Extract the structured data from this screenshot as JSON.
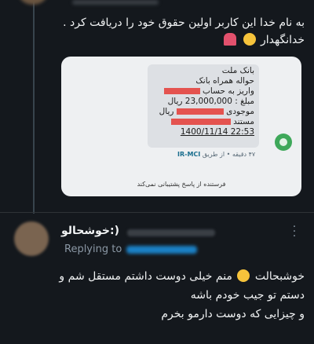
{
  "tweet": {
    "line1": "به نام خدا این کاربر اولین حقوق خود را دریافت کرد .",
    "line2": "خدانگهدار"
  },
  "sms": {
    "line1": "بانک ملت",
    "line2": "حواله همراه بانک",
    "line3": "واریز به حساب",
    "line4": "مبلغ : 23,000,000 ریال",
    "line5": "موجودی",
    "line5b": "ریال",
    "line6": "مستند",
    "line7": "22:53 1400/11/14",
    "meta_time": "۴۷ دقیقه",
    "meta_via": "از طریق",
    "meta_operator": "IR-MCI",
    "footer": "فرستنده از پاسخ پشتیبانی نمی‌کند"
  },
  "reply": {
    "name": "خوشحالو:)",
    "replying_to": "Replying to",
    "line1_a": "خوشبحالت",
    "line1_b": "منم خیلی دوست داشتم مستقل شم و",
    "line2": "دستم تو جیب خودم باشه",
    "line3": "و چیزایی که دوست دارمو بخرم"
  },
  "icons": {
    "more": "more-vertical-icon",
    "emoji_smile": "smirk-emoji-icon",
    "emoji_dancer": "dancer-emoji-icon",
    "emoji_smile2": "smile-emoji-icon"
  },
  "colors": {
    "background": "#14181d",
    "text": "#f1f3f4",
    "muted": "#8b98a5",
    "link": "#1d9bf0",
    "redaction": "#e53935"
  }
}
